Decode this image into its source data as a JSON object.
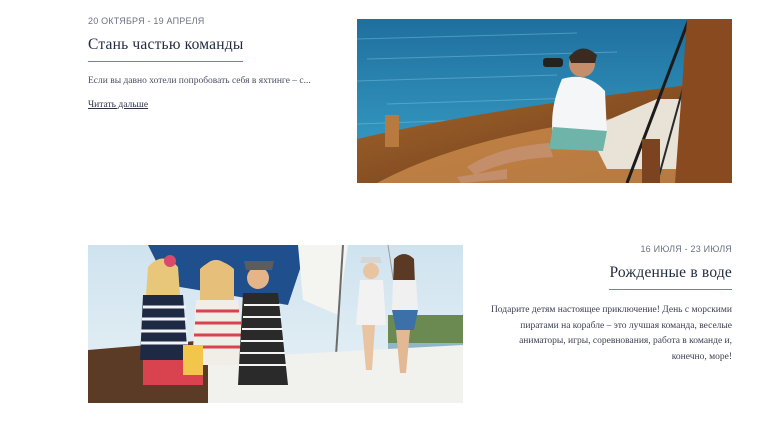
{
  "articles": [
    {
      "date": "20 ОКТЯБРЯ - 19 АПРЕЛЯ",
      "title": "Стань частью команды",
      "excerpt": "Если вы давно хотели попробовать себя в яхтинге – с...",
      "read_more": "Читать дальше"
    },
    {
      "date": "16 ИЮЛЯ - 23 ИЮЛЯ",
      "title": "Рожденные в воде",
      "description": "Подарите детям настоящее приключение! День с морскими пиратами на корабле – это лучшая команда, веселые аниматоры, игры, соревнования, работа в команде и, конечно, море!"
    }
  ],
  "colors": {
    "accent_underline": "#2fa69b",
    "title_text": "#1f2a3d",
    "body_text": "#4a5060"
  }
}
